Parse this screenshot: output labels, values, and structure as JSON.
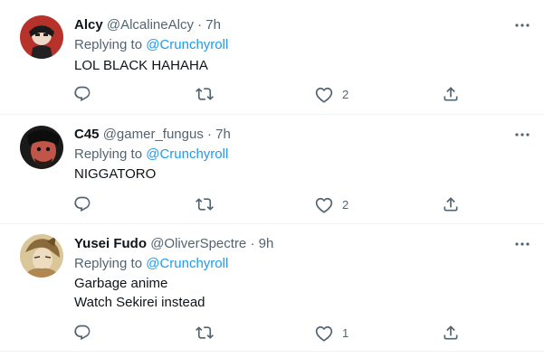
{
  "tweets": [
    {
      "name": "Alcy",
      "handle": "@AlcalineAlcy",
      "dot": "·",
      "time": "7h",
      "replying_prefix": "Replying to",
      "replying_to": "@Crunchyroll",
      "lines": [
        "LOL BLACK HAHAHA"
      ],
      "likes": "2"
    },
    {
      "name": "C45",
      "handle": "@gamer_fungus",
      "dot": "·",
      "time": "7h",
      "replying_prefix": "Replying to",
      "replying_to": "@Crunchyroll",
      "lines": [
        "NIGGATORO"
      ],
      "likes": "2"
    },
    {
      "name": "Yusei Fudo",
      "handle": "@OliverSpectre",
      "dot": "·",
      "time": "9h",
      "replying_prefix": "Replying to",
      "replying_to": "@Crunchyroll",
      "lines": [
        "Garbage anime",
        "Watch Sekirei instead"
      ],
      "likes": "1"
    }
  ],
  "icons": {
    "more": "more-horizontal-icon",
    "reply": "reply-icon",
    "retweet": "retweet-icon",
    "like": "heart-icon",
    "share": "share-icon"
  },
  "colors": {
    "text": "#0f1419",
    "secondary": "#536471",
    "mention": "#1d9bf0",
    "divider": "#eff3f4"
  }
}
